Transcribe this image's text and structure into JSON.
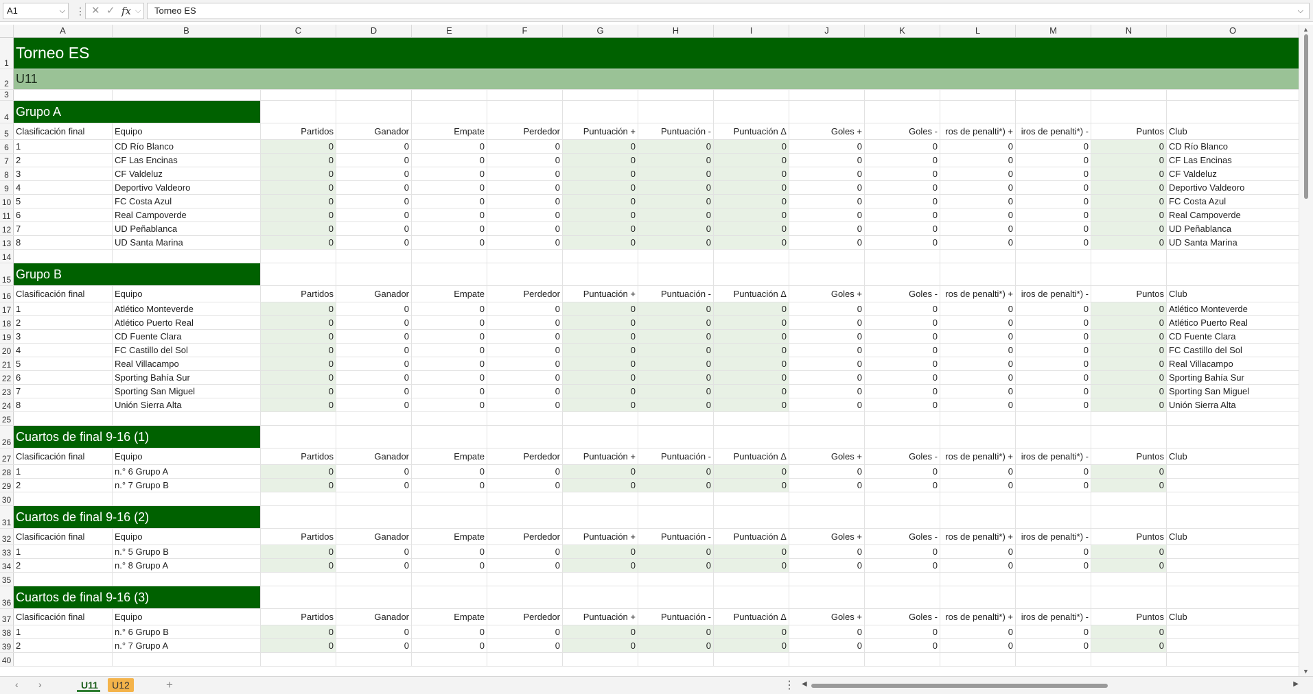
{
  "formula_bar": {
    "cell_ref": "A1",
    "cancel_icon": "✕",
    "confirm_icon": "✓",
    "fx_label": "fx",
    "content": "Torneo ES"
  },
  "columns": [
    "A",
    "B",
    "C",
    "D",
    "E",
    "F",
    "G",
    "H",
    "I",
    "J",
    "K",
    "L",
    "M",
    "N",
    "O"
  ],
  "title": "Torneo ES",
  "subtitle": "U11",
  "headers": [
    "Clasificación final",
    "Equipo",
    "Partidos",
    "Ganador",
    "Empate",
    "Perdedor",
    "Puntuación +",
    "Puntuación -",
    "Puntuación Δ",
    "Goles +",
    "Goles -",
    "ros de penalti*) +",
    "iros de penalti*) -",
    "Puntos",
    "Club"
  ],
  "sections": [
    {
      "name": "Grupo A",
      "title_row": "4",
      "header_row": "5",
      "rows": [
        {
          "rn": "6",
          "rank": "1",
          "team": "CD Río Blanco",
          "club": "CD Río Blanco"
        },
        {
          "rn": "7",
          "rank": "2",
          "team": "CF Las Encinas",
          "club": "CF Las Encinas"
        },
        {
          "rn": "8",
          "rank": "3",
          "team": "CF Valdeluz",
          "club": "CF Valdeluz"
        },
        {
          "rn": "9",
          "rank": "4",
          "team": "Deportivo Valdeoro",
          "club": "Deportivo Valdeoro"
        },
        {
          "rn": "10",
          "rank": "5",
          "team": "FC Costa Azul",
          "club": "FC Costa Azul"
        },
        {
          "rn": "11",
          "rank": "6",
          "team": "Real Campoverde",
          "club": "Real Campoverde"
        },
        {
          "rn": "12",
          "rank": "7",
          "team": "UD Peñablanca",
          "club": "UD Peñablanca"
        },
        {
          "rn": "13",
          "rank": "8",
          "team": "UD Santa Marina",
          "club": "UD Santa Marina"
        }
      ],
      "blank_after": "14"
    },
    {
      "name": "Grupo B",
      "title_row": "15",
      "header_row": "16",
      "rows": [
        {
          "rn": "17",
          "rank": "1",
          "team": "Atlético Monteverde",
          "club": "Atlético Monteverde"
        },
        {
          "rn": "18",
          "rank": "2",
          "team": "Atlético Puerto Real",
          "club": "Atlético Puerto Real"
        },
        {
          "rn": "19",
          "rank": "3",
          "team": "CD Fuente Clara",
          "club": "CD Fuente Clara"
        },
        {
          "rn": "20",
          "rank": "4",
          "team": "FC Castillo del Sol",
          "club": "FC Castillo del Sol"
        },
        {
          "rn": "21",
          "rank": "5",
          "team": "Real Villacampo",
          "club": "Real Villacampo"
        },
        {
          "rn": "22",
          "rank": "6",
          "team": "Sporting Bahía Sur",
          "club": "Sporting Bahía Sur"
        },
        {
          "rn": "23",
          "rank": "7",
          "team": "Sporting San Miguel",
          "club": "Sporting San Miguel"
        },
        {
          "rn": "24",
          "rank": "8",
          "team": "Unión Sierra Alta",
          "club": "Unión Sierra Alta"
        }
      ],
      "blank_after": "25"
    },
    {
      "name": "Cuartos de final  9-16 (1)",
      "title_row": "26",
      "header_row": "27",
      "rows": [
        {
          "rn": "28",
          "rank": "1",
          "team": "n.° 6 Grupo A",
          "club": ""
        },
        {
          "rn": "29",
          "rank": "2",
          "team": "n.° 7 Grupo B",
          "club": ""
        }
      ],
      "blank_after": "30"
    },
    {
      "name": "Cuartos de final  9-16 (2)",
      "title_row": "31",
      "header_row": "32",
      "rows": [
        {
          "rn": "33",
          "rank": "1",
          "team": "n.° 5 Grupo B",
          "club": ""
        },
        {
          "rn": "34",
          "rank": "2",
          "team": "n.° 8 Grupo A",
          "club": ""
        }
      ],
      "blank_after": "35"
    },
    {
      "name": "Cuartos de final  9-16 (3)",
      "title_row": "36",
      "header_row": "37",
      "rows": [
        {
          "rn": "38",
          "rank": "1",
          "team": "n.° 6 Grupo B",
          "club": ""
        },
        {
          "rn": "39",
          "rank": "2",
          "team": "n.° 7 Grupo A",
          "club": ""
        }
      ],
      "blank_after": "40"
    }
  ],
  "zero_value": "0",
  "row_numbers": {
    "r1": "1",
    "r2": "2",
    "r3": "3"
  },
  "sheet_tabs": [
    {
      "label": "U11",
      "active": true
    },
    {
      "label": "U12",
      "color": "#f4b34a"
    }
  ],
  "tab_nav": {
    "prev": "‹",
    "next": "›",
    "add": "+",
    "menu": "⋮"
  },
  "colors": {
    "title_bg": "#006100",
    "header_bg": "#9ac296",
    "shade": "#e8f1e5"
  }
}
